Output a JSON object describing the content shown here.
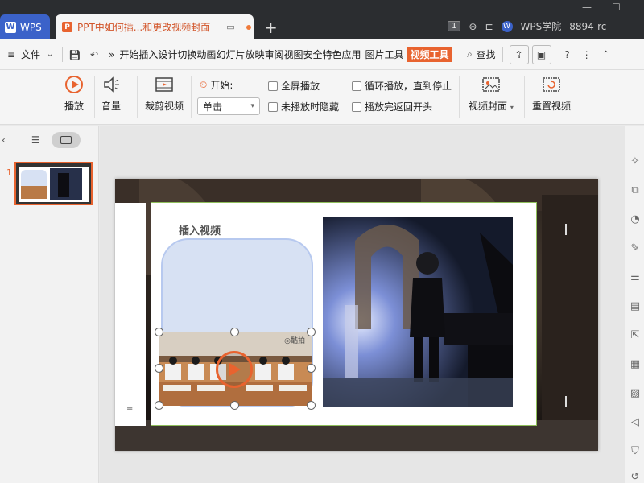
{
  "titlebar": {
    "app_tab": "WPS",
    "doc_tab": "PPT中如何插...和更改视频封面",
    "academy": "WPS学院",
    "account": "8894-rc",
    "badge": "1"
  },
  "menubar": {
    "file": "文件",
    "more": "»",
    "items": [
      "开始",
      "插入",
      "设计",
      "切换",
      "动画",
      "幻灯片放映",
      "审阅",
      "视图",
      "安全",
      "特色应用"
    ],
    "picture_tools": "图片工具",
    "video_tools": "视频工具",
    "search": "查找"
  },
  "ribbon": {
    "play": "播放",
    "volume": "音量",
    "trim": "裁剪视频",
    "start_label": "开始:",
    "start_value": "单击",
    "fullscreen": "全屏播放",
    "hide_when_not_playing": "未播放时隐藏",
    "loop": "循环播放，直到停止",
    "rewind": "播放完返回开头",
    "cover": "视频封面",
    "reset": "重置视频"
  },
  "leftpanel": {
    "slide_number": "1"
  },
  "slide": {
    "title": "插入视频",
    "video_watermark": "◎酷拍"
  },
  "colors": {
    "accent": "#e8632f",
    "wps_blue": "#3b62c9",
    "titlebar": "#2b2d30"
  }
}
